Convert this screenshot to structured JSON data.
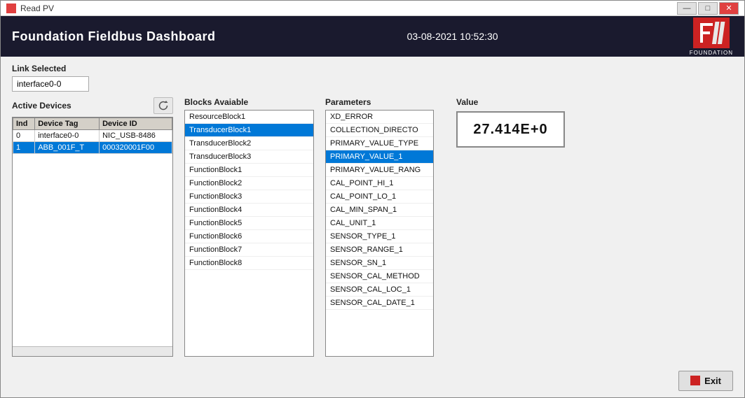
{
  "window": {
    "title": "Read PV",
    "controls": {
      "minimize": "—",
      "maximize": "□",
      "close": "✕"
    }
  },
  "header": {
    "title": "Foundation Fieldbus Dashboard",
    "datetime": "03-08-2021 10:52:30",
    "logo_text": "FOUNDATION"
  },
  "link_section": {
    "label": "Link Selected",
    "value": "interface0-0"
  },
  "active_devices": {
    "title": "Active Devices",
    "columns": [
      "Ind",
      "Device Tag",
      "Device ID"
    ],
    "rows": [
      {
        "index": "0",
        "tag": "interface0-0",
        "id": "NIC_USB-8486",
        "selected": false
      },
      {
        "index": "1",
        "tag": "ABB_001F_T",
        "id": "000320001F00",
        "selected": true
      }
    ]
  },
  "blocks": {
    "title": "Blocks Avaiable",
    "items": [
      {
        "label": "ResourceBlock1",
        "selected": false
      },
      {
        "label": "TransducerBlock1",
        "selected": true
      },
      {
        "label": "TransducerBlock2",
        "selected": false
      },
      {
        "label": "TransducerBlock3",
        "selected": false
      },
      {
        "label": "FunctionBlock1",
        "selected": false
      },
      {
        "label": "FunctionBlock2",
        "selected": false
      },
      {
        "label": "FunctionBlock3",
        "selected": false
      },
      {
        "label": "FunctionBlock4",
        "selected": false
      },
      {
        "label": "FunctionBlock5",
        "selected": false
      },
      {
        "label": "FunctionBlock6",
        "selected": false
      },
      {
        "label": "FunctionBlock7",
        "selected": false
      },
      {
        "label": "FunctionBlock8",
        "selected": false
      }
    ]
  },
  "parameters": {
    "title": "Parameters",
    "items": [
      {
        "label": "XD_ERROR",
        "selected": false
      },
      {
        "label": "COLLECTION_DIRECTO",
        "selected": false
      },
      {
        "label": "PRIMARY_VALUE_TYPE",
        "selected": false
      },
      {
        "label": "PRIMARY_VALUE_1",
        "selected": true
      },
      {
        "label": "PRIMARY_VALUE_RANG",
        "selected": false
      },
      {
        "label": "CAL_POINT_HI_1",
        "selected": false
      },
      {
        "label": "CAL_POINT_LO_1",
        "selected": false
      },
      {
        "label": "CAL_MIN_SPAN_1",
        "selected": false
      },
      {
        "label": "CAL_UNIT_1",
        "selected": false
      },
      {
        "label": "SENSOR_TYPE_1",
        "selected": false
      },
      {
        "label": "SENSOR_RANGE_1",
        "selected": false
      },
      {
        "label": "SENSOR_SN_1",
        "selected": false
      },
      {
        "label": "SENSOR_CAL_METHOD",
        "selected": false
      },
      {
        "label": "SENSOR_CAL_LOC_1",
        "selected": false
      },
      {
        "label": "SENSOR_CAL_DATE_1",
        "selected": false
      }
    ]
  },
  "value": {
    "label": "Value",
    "display": "27.414E+0"
  },
  "footer": {
    "exit_label": "Exit"
  },
  "colors": {
    "selected_bg": "#0078d7",
    "header_bg": "#1a1a2e",
    "accent_red": "#cc2222"
  }
}
